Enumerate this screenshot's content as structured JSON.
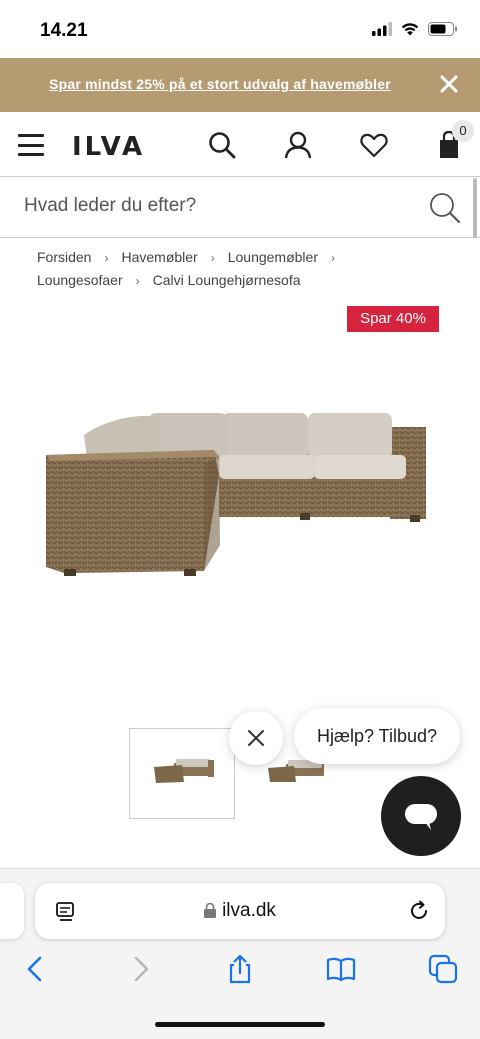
{
  "status_bar": {
    "time": "14.21"
  },
  "promo": {
    "text": "Spar mindst 25% på et stort udvalg af havemøbler"
  },
  "header": {
    "logo": "ILVA",
    "cart_count": "0"
  },
  "search": {
    "placeholder": "Hvad leder du efter?"
  },
  "breadcrumb": {
    "items": [
      "Forsiden",
      "Havemøbler",
      "Loungemøbler",
      "Loungesofaer",
      "Calvi Loungehjørnesofa"
    ],
    "separator": "›"
  },
  "product": {
    "badge": "Spar 40%"
  },
  "help": {
    "bubble_text": "Hjælp? Tilbud?"
  },
  "browser": {
    "url": "ilva.dk"
  },
  "colors": {
    "promo_bg": "#b59a72",
    "badge_bg": "#d6243f",
    "link_blue": "#1a73e8"
  }
}
